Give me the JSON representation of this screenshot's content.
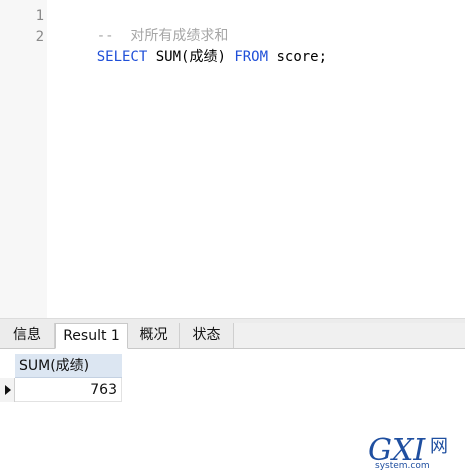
{
  "editor": {
    "lines": [
      {
        "number": "1",
        "comment": "--  对所有成绩求和"
      },
      {
        "number": "2",
        "kw1": "SELECT",
        "mid": " SUM(成绩) ",
        "kw2": "FROM",
        "tail": " score;"
      }
    ]
  },
  "tabs": [
    {
      "label": "信息",
      "active": false
    },
    {
      "label": "Result 1",
      "active": true
    },
    {
      "label": "概况",
      "active": false
    },
    {
      "label": "状态",
      "active": false
    }
  ],
  "result": {
    "columns": [
      "SUM(成绩)"
    ],
    "rows": [
      [
        "763"
      ]
    ]
  },
  "watermark": {
    "big": "GXI",
    "cn": "网",
    "site": "system.com"
  },
  "colors": {
    "keyword": "#1f4fd8",
    "comment": "#a6a6a6",
    "header_bg": "#dce6f2",
    "watermark": "#1f4fa0"
  }
}
